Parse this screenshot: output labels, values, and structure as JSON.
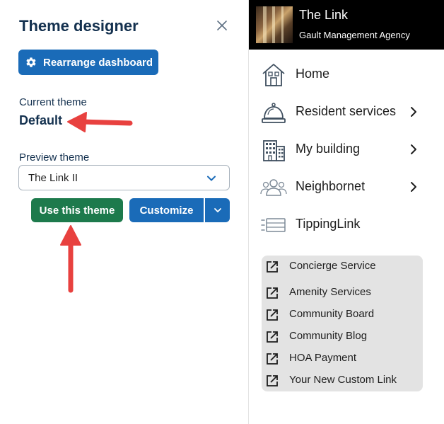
{
  "panel": {
    "title": "Theme designer",
    "rearrange_label": "Rearrange dashboard",
    "current_theme_label": "Current theme",
    "current_theme_value": "Default",
    "preview_theme_label": "Preview theme",
    "preview_theme_selected": "The Link II",
    "use_theme_label": "Use this theme",
    "customize_label": "Customize"
  },
  "brand": {
    "title": "The Link",
    "subtitle": "Gault Management Agency"
  },
  "nav": {
    "items": [
      {
        "label": "Home",
        "icon": "house-icon",
        "has_submenu": false
      },
      {
        "label": "Resident services",
        "icon": "service-bell-icon",
        "has_submenu": true
      },
      {
        "label": "My building",
        "icon": "building-icon",
        "has_submenu": true
      },
      {
        "label": "Neighbornet",
        "icon": "people-icon",
        "has_submenu": true
      },
      {
        "label": "TippingLink",
        "icon": "list-card-icon",
        "has_submenu": false
      }
    ]
  },
  "links": {
    "items": [
      "Concierge Service",
      "Amenity Services",
      "Community Board",
      "Community Blog",
      "HOA Payment",
      "Your New Custom Link"
    ]
  },
  "colors": {
    "primary_blue": "#1a6bb8",
    "success_green": "#1d7a4c",
    "title_navy": "#14314f",
    "annotation_red": "#e8413f",
    "brand_bar": "#000000",
    "links_bg": "#e3e3e3"
  }
}
